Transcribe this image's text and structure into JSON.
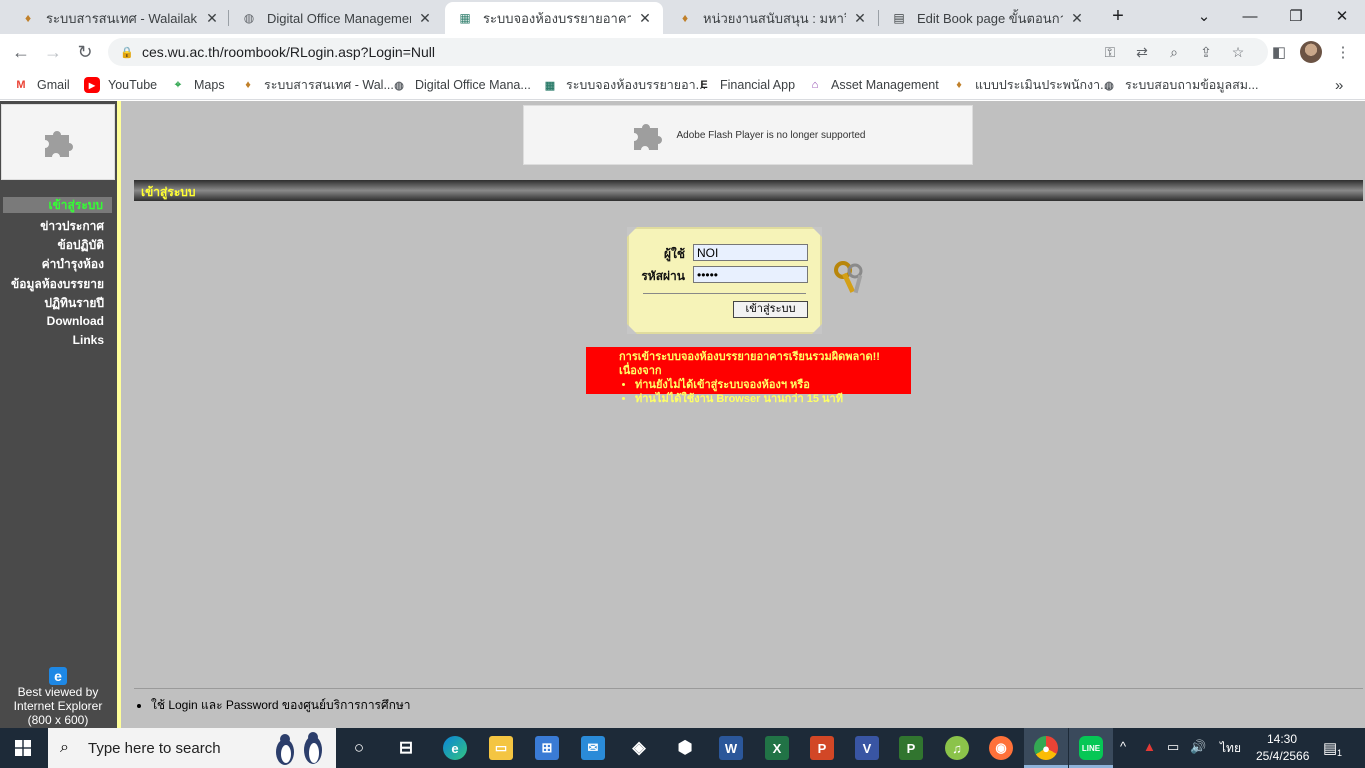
{
  "browser": {
    "tabs": [
      {
        "title": "ระบบสารสนเทศ - Walailak Univ",
        "icon": "university-seal-icon",
        "active": false
      },
      {
        "title": "Digital Office Management S",
        "icon": "globe-icon",
        "active": false
      },
      {
        "title": "ระบบจองห้องบรรยายอาคารเรียนร",
        "icon": "building-icon",
        "active": true
      },
      {
        "title": "หน่วยงานสนับสนุน : มหาวิทยาลัย",
        "icon": "university-seal-icon",
        "active": false
      },
      {
        "title": "Edit Book page ขั้นตอนการปฏิ",
        "icon": "book-icon",
        "active": false
      }
    ],
    "close_glyph": "✕",
    "new_tab_glyph": "+",
    "url": "ces.wu.ac.th/roombook/RLogin.asp?Login=Null",
    "bookmarks": [
      {
        "label": "Gmail",
        "icon": "gmail-icon",
        "color": "#ea4335"
      },
      {
        "label": "YouTube",
        "icon": "youtube-icon",
        "color": "#ff0000"
      },
      {
        "label": "Maps",
        "icon": "maps-icon",
        "color": "#34a853"
      },
      {
        "label": "ระบบสารสนเทศ - Wal...",
        "icon": "university-seal-icon",
        "color": "#c0802a"
      },
      {
        "label": "Digital Office Mana...",
        "icon": "globe-icon",
        "color": "#5f6368"
      },
      {
        "label": "ระบบจองห้องบรรยายอา...",
        "icon": "building-icon",
        "color": "#2e7d6b"
      },
      {
        "label": "Financial App",
        "icon": "e-letter-icon",
        "color": "#222222"
      },
      {
        "label": "Asset Management",
        "icon": "temple-icon",
        "color": "#8e44ad"
      },
      {
        "label": "แบบประเมินประพนักงา...",
        "icon": "university-seal-icon",
        "color": "#c0802a"
      },
      {
        "label": "ระบบสอบถามข้อมูลสม...",
        "icon": "globe-icon",
        "color": "#5f6368"
      }
    ]
  },
  "page": {
    "flash_notice": "Adobe Flash Player is no longer supported",
    "section_title": "เข้าสู่ระบบ",
    "menu": [
      {
        "label": "เข้าสู่ระบบ",
        "active": true
      },
      {
        "label": "ข่าวประกาศ",
        "active": false
      },
      {
        "label": "ข้อปฏิบัติ",
        "active": false
      },
      {
        "label": "ค่าบำรุงห้อง",
        "active": false
      },
      {
        "label": "ข้อมูลห้องบรรยาย",
        "active": false
      },
      {
        "label": "ปฏิทินรายปี",
        "active": false
      },
      {
        "label": "Download",
        "active": false
      },
      {
        "label": "Links",
        "active": false
      }
    ],
    "browser_note": {
      "line1": "Best viewed by",
      "line2": "Internet Explorer",
      "line3": "(800 x 600)"
    },
    "login": {
      "user_label": "ผู้ใช้",
      "user_value": "NOI",
      "password_label": "รหัสผ่าน",
      "password_value": "•••••",
      "submit_label": "เข้าสู่ระบบ"
    },
    "error": {
      "heading": "การเข้าระบบจองห้องบรรยายอาคารเรียนรวมผิดพลาด!! เนื่องจาก",
      "reasons": [
        "ท่านยังไม่ได้เข้าสู่ระบบจองห้องฯ หรือ",
        "ท่านไม่ได้ใช้งาน Browser นานกว่า 15 นาที"
      ]
    },
    "footer_note": "ใช้ Login และ Password ของศูนย์บริการการศึกษา"
  },
  "taskbar": {
    "search_placeholder": "Type here to search",
    "apps": [
      "task-view-icon",
      "widgets-icon",
      "edge-icon",
      "file-explorer-icon",
      "store-icon",
      "mail-icon",
      "remote-icon",
      "app-icon",
      "word-icon",
      "excel-icon",
      "powerpoint-icon",
      "visio-icon",
      "project-icon",
      "music-icon",
      "firefox-icon",
      "chrome-icon",
      "line-icon"
    ],
    "language": "ไทย",
    "time": "14:30",
    "date": "25/4/2566",
    "notification_count": "1"
  },
  "colors": {
    "page_bg": "#c0c0c0",
    "nav_bg": "#4a4a4a",
    "menu_active": "#33ff33",
    "section_title": "#ffff33",
    "error_bg": "#ff0000",
    "error_text": "#ffff66",
    "login_bg": "#f6f3b8"
  }
}
